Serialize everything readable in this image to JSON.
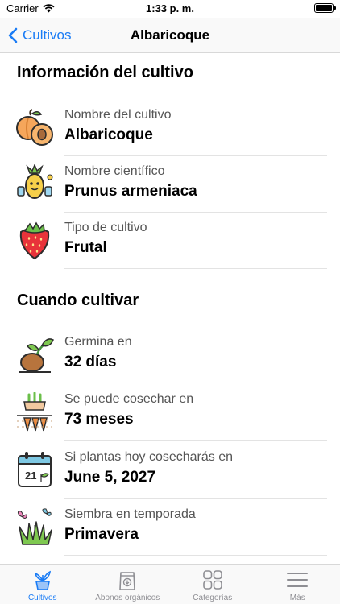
{
  "status_bar": {
    "carrier": "Carrier",
    "time": "1:33 p. m."
  },
  "nav": {
    "back_label": "Cultivos",
    "title": "Albaricoque"
  },
  "sections": {
    "info": {
      "title": "Información del cultivo",
      "rows": [
        {
          "icon": "apricot-icon",
          "label": "Nombre del cultivo",
          "value": "Albaricoque"
        },
        {
          "icon": "scientist-pineapple-icon",
          "label": "Nombre científico",
          "value": "Prunus armeniaca"
        },
        {
          "icon": "strawberry-icon",
          "label": "Tipo de cultivo",
          "value": "Frutal"
        }
      ]
    },
    "when": {
      "title": "Cuando cultivar",
      "rows": [
        {
          "icon": "sprouting-seed-icon",
          "label": "Germina en",
          "value": "32 días"
        },
        {
          "icon": "harvest-hands-icon",
          "label": "Se puede cosechar en",
          "value": "73 meses"
        },
        {
          "icon": "calendar-icon",
          "label": "Si plantas hoy cosecharás en",
          "value": "June 5, 2027"
        },
        {
          "icon": "butterfly-grass-icon",
          "label": "Siembra en temporada",
          "value": "Primavera"
        }
      ]
    }
  },
  "calendar_day": "21",
  "tabs": [
    {
      "icon": "plant-pot-icon",
      "label": "Cultivos",
      "active": true
    },
    {
      "icon": "fertilizer-bag-icon",
      "label": "Abonos orgánicos",
      "active": false
    },
    {
      "icon": "grid-icon",
      "label": "Categorías",
      "active": false
    },
    {
      "icon": "hamburger-menu-icon",
      "label": "Más",
      "active": false
    }
  ],
  "colors": {
    "accent": "#1a7cf5",
    "inactive_tab": "#8e8e93"
  }
}
